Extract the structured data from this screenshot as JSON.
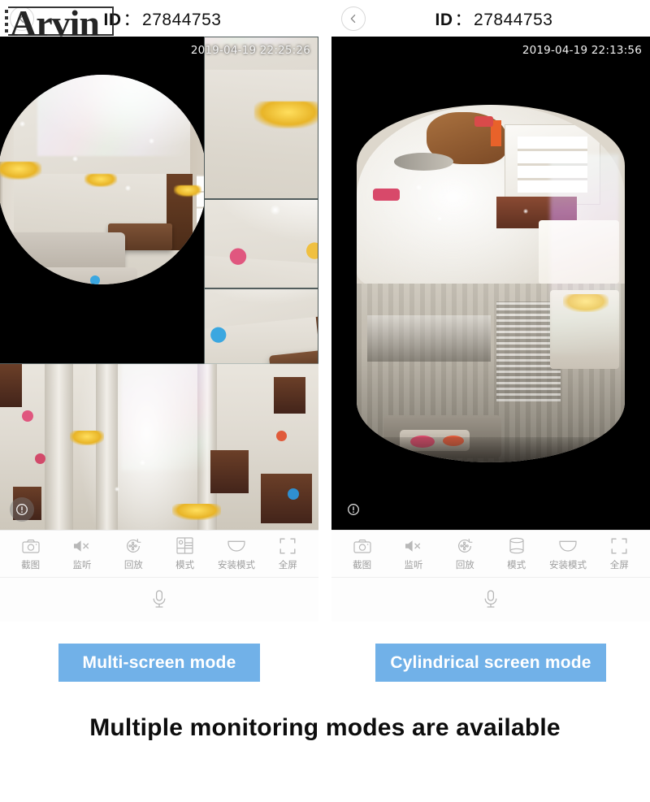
{
  "watermark": {
    "text": "Arvin"
  },
  "panels": [
    {
      "id": "multi-screen",
      "header": {
        "id_label": "ID",
        "separator": "：",
        "id_value": "27844753",
        "back_icon": "chevron-left-icon"
      },
      "video": {
        "timestamp": "2019-04-19 22:25:26",
        "alert_icon": "alert-exclamation-icon",
        "view_mode": "multi-screen"
      },
      "toolbar": [
        {
          "icon": "camera-icon",
          "label": "截图"
        },
        {
          "icon": "speaker-muted-icon",
          "label": "监听"
        },
        {
          "icon": "playback-icon",
          "label": "回放"
        },
        {
          "icon": "grid-mode-icon",
          "label": "模式"
        },
        {
          "icon": "dome-mount-icon",
          "label": "安装模式"
        },
        {
          "icon": "fullscreen-icon",
          "label": "全屏"
        }
      ],
      "mic": {
        "icon": "microphone-icon"
      },
      "caption": "Multi-screen mode"
    },
    {
      "id": "cylindrical-screen",
      "header": {
        "id_label": "ID",
        "separator": "：",
        "id_value": "27844753",
        "back_icon": "chevron-left-icon"
      },
      "video": {
        "timestamp": "2019-04-19 22:13:56",
        "alert_icon": "alert-exclamation-icon",
        "view_mode": "cylindrical"
      },
      "toolbar": [
        {
          "icon": "camera-icon",
          "label": "截图"
        },
        {
          "icon": "speaker-muted-icon",
          "label": "监听"
        },
        {
          "icon": "playback-icon",
          "label": "回放"
        },
        {
          "icon": "cylinder-mode-icon",
          "label": "模式"
        },
        {
          "icon": "dome-mount-icon",
          "label": "安装模式"
        },
        {
          "icon": "fullscreen-icon",
          "label": "全屏"
        }
      ],
      "mic": {
        "icon": "microphone-icon"
      },
      "caption": "Cylindrical screen mode"
    }
  ],
  "footer": {
    "headline": "Multiple monitoring modes are available"
  },
  "colors": {
    "caption_bg": "#71b1e8",
    "caption_text": "#ffffff",
    "toolbar_text": "#9e9e9e",
    "toolbar_icon": "#b8b8b8",
    "header_text": "#111111",
    "video_bg": "#000000",
    "footer_text": "#0d0d0d"
  }
}
